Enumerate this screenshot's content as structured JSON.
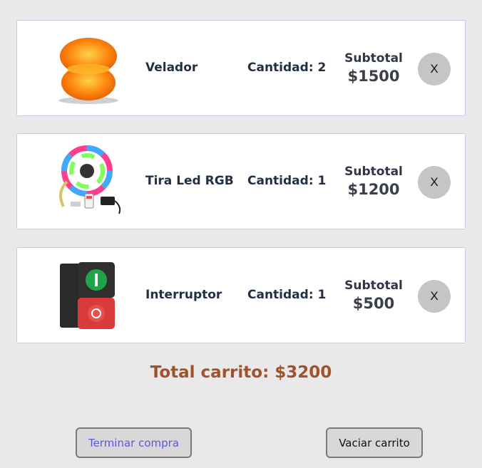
{
  "cart": {
    "items": [
      {
        "name": "Velador",
        "quantity": "Cantidad: 2",
        "subtotal_label": "Subtotal",
        "subtotal": "$1500",
        "remove": "X"
      },
      {
        "name": "Tira Led RGB",
        "quantity": "Cantidad: 1",
        "subtotal_label": "Subtotal",
        "subtotal": "$1200",
        "remove": "X"
      },
      {
        "name": "Interruptor",
        "quantity": "Cantidad: 1",
        "subtotal_label": "Subtotal",
        "subtotal": "$500",
        "remove": "X"
      }
    ],
    "total": "Total carrito: $3200"
  },
  "actions": {
    "checkout_label": "Terminar compra",
    "empty_label": "Vaciar carrito"
  },
  "colors": {
    "background": "#e9e9e9",
    "total_text": "#a0522d",
    "checkout_text": "#5a5ad8",
    "card_border": "#c9c9ee"
  }
}
